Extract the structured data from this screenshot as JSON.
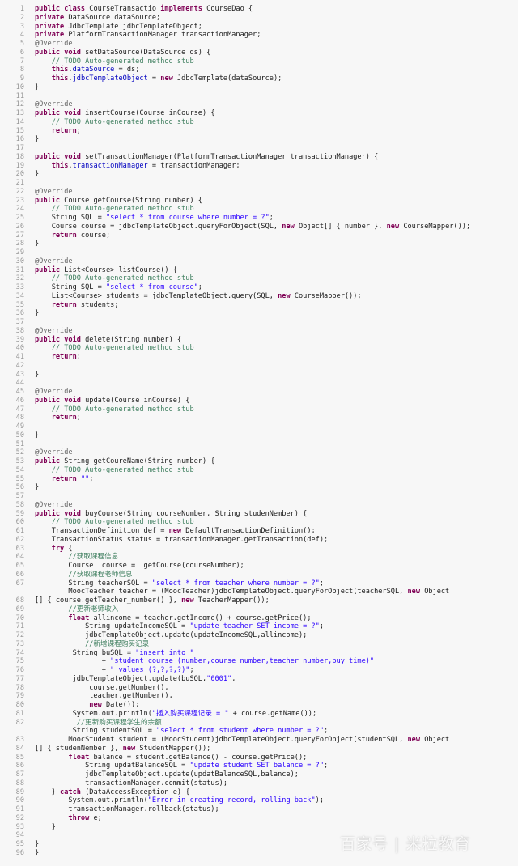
{
  "editor": {
    "lines": [
      "public class CourseTransactio implements CourseDao {",
      "private DataSource dataSource;",
      "private JdbcTemplate jdbcTemplateObject;",
      "private PlatformTransactionManager transactionManager;",
      "@Override",
      "public void setDataSource(DataSource ds) {",
      "    // TODO Auto-generated method stub",
      "    this.dataSource = ds;",
      "    this.jdbcTemplateObject = new JdbcTemplate(dataSource);",
      "}",
      "",
      "@Override",
      "public void insertCourse(Course inCourse) {",
      "    // TODO Auto-generated method stub",
      "    return;",
      "}",
      "",
      "public void setTransactionManager(PlatformTransactionManager transactionManager) {",
      "    this.transactionManager = transactionManager;",
      "}",
      "",
      "@Override",
      "public Course getCourse(String number) {",
      "    // TODO Auto-generated method stub",
      "    String SQL = \"select * from course where number = ?\";",
      "    Course course = jdbcTemplateObject.queryForObject(SQL, new Object[] { number }, new CourseMapper());",
      "    return course;",
      "}",
      "",
      "@Override",
      "public List<Course> listCourse() {",
      "    // TODO Auto-generated method stub",
      "    String SQL = \"select * from course\";",
      "    List<Course> students = jdbcTemplateObject.query(SQL, new CourseMapper());",
      "    return students;",
      "}",
      "",
      "@Override",
      "public void delete(String number) {",
      "    // TODO Auto-generated method stub",
      "    return;",
      "",
      "}",
      "",
      "@Override",
      "public void update(Course inCourse) {",
      "    // TODO Auto-generated method stub",
      "    return;",
      "",
      "}",
      "",
      "@Override",
      "public String getCoureName(String number) {",
      "    // TODO Auto-generated method stub",
      "    return \"\";",
      "}",
      "",
      "@Override",
      "public void buyCourse(String courseNumber, String studenNember) {",
      "    // TODO Auto-generated method stub",
      "    TransactionDefinition def = new DefaultTransactionDefinition();",
      "    TransactionStatus status = transactionManager.getTransaction(def);",
      "    try {",
      "        //获取课程信息",
      "        Course  course =  getCourse(courseNumber);",
      "        //获取课程老师信息",
      "        String teacherSQL = \"select * from teacher where number = ?\";",
      "        MoocTeacher teacher = (MoocTeacher)jdbcTemplateObject.queryForObject(teacherSQL, new Object",
      "[] { course.getTeacher_number() }, new TeacherMapper());",
      "        //更新老师收入",
      "        float allincome = teacher.getIncome() + course.getPrice();",
      "            String updateIncomeSQL = \"update teacher SET income = ?\";",
      "            jdbcTemplateObject.update(updateIncomeSQL,allincome);",
      "            //新增课程购买记录",
      "         String buSQL = \"insert into \"",
      "                + \"student_course (number,course_number,teacher_number,buy_time)\"",
      "                + \" values (?,?,?,?)\";",
      "         jdbcTemplateObject.update(buSQL,\"0001\",",
      "             course.getNumber(),",
      "             teacher.getNumber(),",
      "             new Date());",
      "         System.out.println(\"插入购买课程记录 = \" + course.getName());",
      "          //更新购买课程学生的余额",
      "         String studentSQL = \"select * from student where number = ?\";",
      "        MoocStudent student = (MoocStudent)jdbcTemplateObject.queryForObject(studentSQL, new Object",
      "[] { studenNember }, new StudentMapper());",
      "        float balance = student.getBalance() - course.getPrice();",
      "            String updatBalanceSQL = \"update student SET balance = ?\";",
      "            jdbcTemplateObject.update(updatBalanceSQL,balance);",
      "            transactionManager.commit(status);",
      "    } catch (DataAccessException e) {",
      "        System.out.println(\"Error in creating record, rolling back\");",
      "        transactionManager.rollback(status);",
      "        throw e;",
      "    }",
      "",
      "}",
      "}"
    ],
    "line_numbers": [
      "1",
      "2",
      "3",
      "4",
      "5",
      "6",
      "7",
      "8",
      "9",
      "10",
      "11",
      "12",
      "13",
      "14",
      "15",
      "16",
      "17",
      "18",
      "19",
      "20",
      "21",
      "22",
      "23",
      "24",
      "25",
      "26",
      "27",
      "28",
      "29",
      "30",
      "31",
      "32",
      "33",
      "34",
      "35",
      "36",
      "37",
      "38",
      "39",
      "40",
      "41",
      "42",
      "43",
      "44",
      "45",
      "46",
      "47",
      "48",
      "49",
      "50",
      "51",
      "52",
      "53",
      "54",
      "55",
      "56",
      "57",
      "58",
      "59",
      "60",
      "61",
      "62",
      "63",
      "64",
      "65",
      "66",
      "67",
      "",
      "68",
      "69",
      "70",
      "71",
      "72",
      "73",
      "74",
      "75",
      "76",
      "77",
      "78",
      "79",
      "80",
      "81",
      "82",
      "",
      "83",
      "84",
      "85",
      "86",
      "87",
      "88",
      "89",
      "90",
      "91",
      "92",
      "93",
      "94",
      "95",
      "96",
      "",
      ""
    ]
  },
  "watermark": "百家号 | 米粒教育"
}
